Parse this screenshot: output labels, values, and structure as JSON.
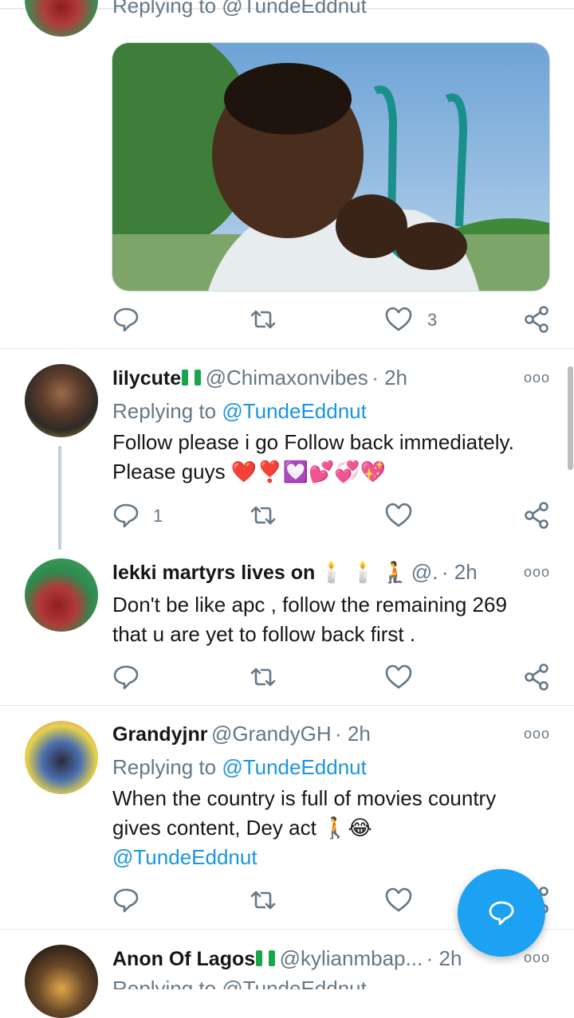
{
  "top_partial": {
    "replying_text": "Replying to @TundeEddnut"
  },
  "first_tweet": {
    "like_count": "3"
  },
  "tweets": [
    {
      "display_name": "lilycute",
      "handle": "@Chimaxonvibes",
      "time": "· 2h",
      "replying_prefix": "Replying to ",
      "replying_handle": "@TundeEddnut",
      "text_line1": "Follow please i go Follow back immediately.",
      "text_line2": "Please guys",
      "reply_count": "1"
    },
    {
      "display_name": "lekki martyrs lives on",
      "handle": "@.",
      "time": "· 2h",
      "text_line1": "Don't be like apc , follow the remaining 269",
      "text_line2": "that u are yet to follow back first ."
    },
    {
      "display_name": "Grandyjnr",
      "handle": "@GrandyGH",
      "time": "· 2h",
      "replying_prefix": "Replying to ",
      "replying_handle": "@TundeEddnut",
      "text_line1": "When the country is full of movies country",
      "text_line2": "gives content, Dey act",
      "text_line3": "@TundeEddnut"
    },
    {
      "display_name": "Anon Of Lagos",
      "handle": "@kylianmbap...",
      "time": "· 2h",
      "replying_text": "Replying to @TundeEddnut"
    }
  ],
  "more_icon_text": "ooo",
  "colors": {
    "accent": "#1da1f2",
    "link": "#1b95e0",
    "muted": "#657786",
    "heart": "#e0245e"
  },
  "icons": [
    "reply-icon",
    "retweet-icon",
    "like-icon",
    "share-icon",
    "more-icon",
    "compose-reply-icon"
  ]
}
